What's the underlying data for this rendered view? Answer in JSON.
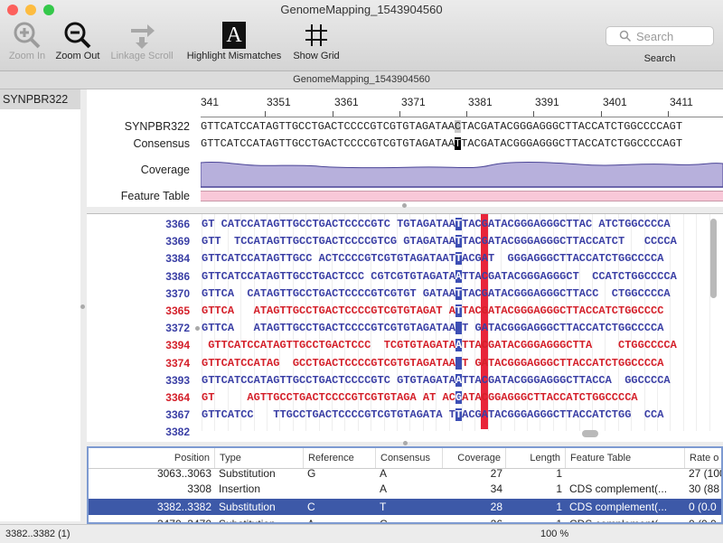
{
  "window": {
    "title": "GenomeMapping_1543904560",
    "document_tab": "GenomeMapping_1543904560",
    "traffic_lights": [
      "#fc605c",
      "#fdbc40",
      "#34c84a"
    ]
  },
  "toolbar": {
    "zoom_in": "Zoom In",
    "zoom_out": "Zoom Out",
    "linkage_scroll": "Linkage Scroll",
    "highlight_mismatches": "Highlight Mismatches",
    "highlight_icon_glyph": "A",
    "show_grid": "Show Grid",
    "search_placeholder": "Search",
    "search_label": "Search"
  },
  "sidebar": {
    "selected_item": "SYNPBR322"
  },
  "ruler": {
    "first_partial": "341",
    "numbers": [
      "3351",
      "3361",
      "3371",
      "3381",
      "3391",
      "3401",
      "3411"
    ]
  },
  "tracks": {
    "reference_label": "SYNPBR322",
    "consensus_label": "Consensus",
    "coverage_label": "Coverage",
    "feature_label": "Feature Table",
    "reference_seq": "GTTCATCCATAGTTGCCTGACTCCCCGTCGTGTAGATAACTACGATACGGGAGGGCTTACCATCTGGCCCCAGT",
    "consensus_seq": "GTTCATCCATAGTTGCCTGACTCCCCGTCGTGTAGATAATTACGATACGGGAGGGCTTACCATCTGGCCCCAGT",
    "mismatch_col": 39
  },
  "reads": [
    {
      "id": "3366",
      "color": "blue",
      "seq": "GT CATCCATAGTTGCCTGACTCCCCGTC TGTAGATAATTACGATACGGGAGGGCTTAC ATCTGGCCCCA"
    },
    {
      "id": "3369",
      "color": "blue",
      "seq": "GTT  TCCATAGTTGCCTGACTCCCCGTCG GTAGATAATTACGATACGGGAGGGCTTACCATCT   CCCCA"
    },
    {
      "id": "3384",
      "color": "blue",
      "seq": "GTTCATCCATAGTTGCC ACTCCCCGTCGTGTAGATAATTACGAT  GGGAGGGCTTACCATCTGGCCCCA"
    },
    {
      "id": "3386",
      "color": "blue",
      "seq": "GTTCATCCATAGTTGCCTGACTCCC CGTCGTGTAGATAATTACGATACGGGAGGGCT  CCATCTGGCCCCA"
    },
    {
      "id": "3370",
      "color": "blue",
      "seq": "GTTCA  CATAGTTGCCTGACTCCCCGTCGTGT GATAATTACGATACGGGAGGGCTTACC  CTGGCCCCA"
    },
    {
      "id": "3365",
      "color": "red",
      "seq": "GTTCA   ATAGTTGCCTGACTCCCCGTCGTGTAGAT ATTACGATACGGGAGGGCTTACCATCTGGCCCC"
    },
    {
      "id": "3372",
      "color": "blue",
      "seq": "GTTCA   ATAGTTGCCTGACTCCCCGTCGTGTAGATAA T GATACGGGAGGGCTTACCATCTGGCCCCA"
    },
    {
      "id": "3394",
      "color": "red",
      "seq": " GTTCATCCATAGTTGCCTGACTCCC  TCGTGTAGATAATTACGATACGGGAGGGCTTA    CTGGCCCCA"
    },
    {
      "id": "3374",
      "color": "red",
      "seq": "GTTCATCCATAG  GCCTGACTCCCCGTCGTGTAGATAA T GATACGGGAGGGCTTACCATCTGGCCCCA"
    },
    {
      "id": "3393",
      "color": "blue",
      "seq": "GTTCATCCATAGTTGCCTGACTCCCCGTC GTGTAGATAATTACGATACGGGAGGGCTTACCA  GGCCCCA"
    },
    {
      "id": "3364",
      "color": "red",
      "seq": "GT     AGTTGCCTGACTCCCCGTCGTGTAGA AT ACGATACGGAGGGCTTACCATCTGGCCCCA"
    },
    {
      "id": "3367",
      "color": "blue",
      "seq": "GTTCATCC   TTGCCTGACTCCCCGTCGTGTAGATA TTACGATACGGGAGGGCTTACCATCTGG  CCA"
    },
    {
      "id": "3382",
      "color": "blue",
      "seq": ""
    }
  ],
  "table": {
    "headers": [
      "Position",
      "Type",
      "Reference",
      "Consensus",
      "Coverage",
      "Length",
      "Feature Table",
      "Rate o"
    ],
    "rows": [
      [
        "3063..3063",
        "Substitution",
        "G",
        "A",
        "27",
        "1",
        "",
        "27 (100"
      ],
      [
        "3308",
        "Insertion",
        "",
        "A",
        "34",
        "1",
        "CDS complement(...",
        "30 (88"
      ],
      [
        "3382..3382",
        "Substitution",
        "C",
        "T",
        "28",
        "1",
        "CDS complement(...",
        "0 (0.0"
      ],
      [
        "3470..3470",
        "Substitution",
        "A",
        "C",
        "26",
        "1",
        "CDS complement(...",
        "0 (0.0"
      ]
    ],
    "selected_row": 2
  },
  "statusbar": {
    "selection": "3382..3382 (1)",
    "zoom": "100 %"
  },
  "colors": {
    "read_blue": "#3a3fa5",
    "read_red": "#d4202a",
    "highlight_red": "#e8253a",
    "coverage_fill": "#b7b0dc",
    "feature_fill": "#f8c8d8",
    "selection_blue": "#3d59a8"
  }
}
